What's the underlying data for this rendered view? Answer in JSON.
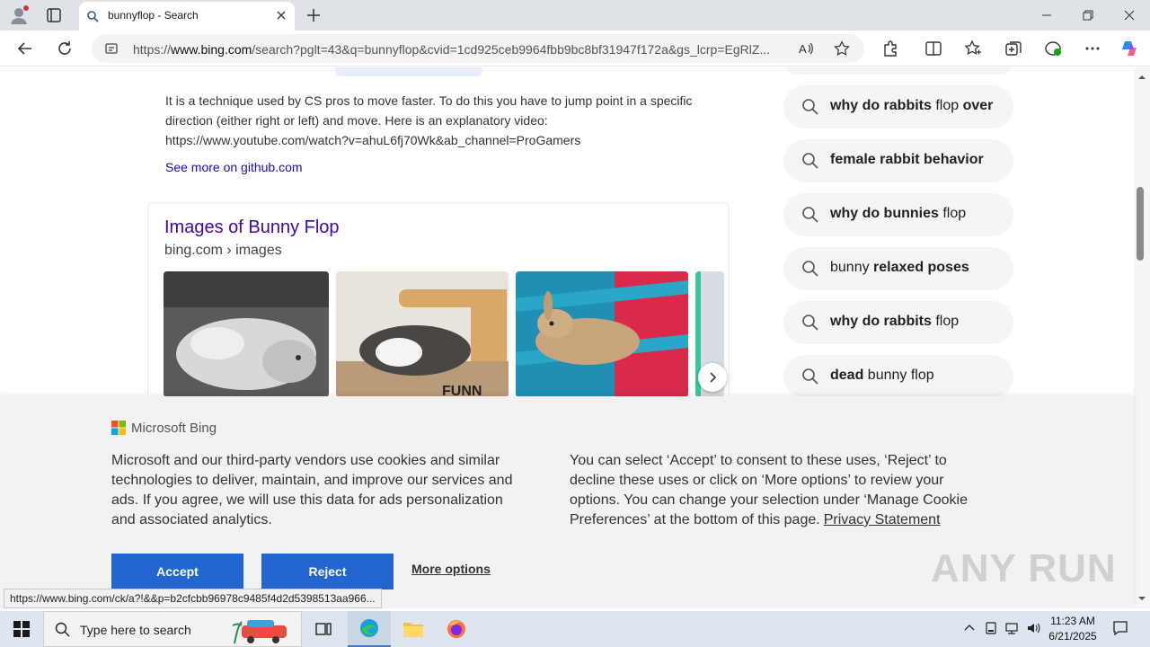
{
  "browser": {
    "tab_title": "bunnyflop - Search",
    "url_prefix": "https://",
    "url_host": "www.bing.com",
    "url_rest": "/search?pglt=43&q=bunnyflop&cvid=1cd925ceb9964fbb9bc8bf31947f172a&gs_lcrp=EgRlZ...",
    "status_url": "https://www.bing.com/ck/a?!&&p=b2cfcbb96978c9485f4d2d5398513aa966..."
  },
  "result": {
    "snippet": "It is a technique used by CS pros to move faster. To do this you have to jump point in a specific direction (either right or left) and move. Here is an explanatory video: https://www.youtube.com/watch?v=ahuL6fj70Wk&ab_channel=ProGamers",
    "see_more": "See more on github.com"
  },
  "images": {
    "title": "Images of Bunny Flop",
    "source": "bing.com › images"
  },
  "related": [
    {
      "bold": "why do rabbits",
      "normal": " flop ",
      "bold2": "over"
    },
    {
      "bold": "female rabbit behavior",
      "normal": "",
      "bold2": ""
    },
    {
      "bold": "why do bunnies",
      "normal": " flop",
      "bold2": ""
    },
    {
      "bold": "bunny ",
      "normal": "",
      "bold2": "relaxed poses"
    },
    {
      "bold": "why do rabbits",
      "normal": " flop",
      "bold2": ""
    },
    {
      "bold": "dead",
      "normal": " bunny flop",
      "bold2": ""
    }
  ],
  "cookie": {
    "brand": "Microsoft Bing",
    "left_text": "Microsoft and our third-party vendors use cookies and similar technologies to deliver, maintain, and improve our services and ads. If you agree, we will use this data for ads personalization and associated analytics.",
    "right_text": "You can select ‘Accept’ to consent to these uses, ‘Reject’ to decline these uses or click on ‘More options’ to review your options. You can change your selection under ‘Manage Cookie Preferences’ at the bottom of this page.",
    "privacy_link": "Privacy Statement",
    "accept": "Accept",
    "reject": "Reject",
    "more_options": "More options"
  },
  "watermark": "ANY RUN",
  "taskbar": {
    "search_placeholder": "Type here to search",
    "time": "11:23 AM",
    "date": "6/21/2025"
  }
}
